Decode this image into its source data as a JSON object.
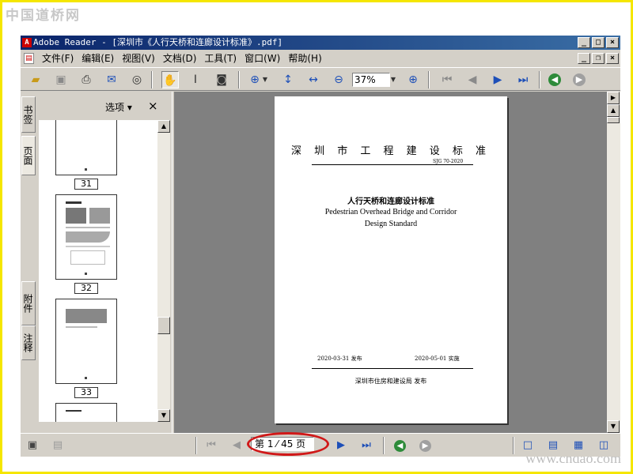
{
  "watermark": {
    "top": "中国道桥网",
    "bottom": "www.cndao.com"
  },
  "window": {
    "title": "Adobe Reader - [深圳市《人行天桥和连廊设计标准》.pdf]"
  },
  "menu": [
    "文件(F)",
    "编辑(E)",
    "视图(V)",
    "文档(D)",
    "工具(T)",
    "窗口(W)",
    "帮助(H)"
  ],
  "toolbar": {
    "zoom": "37%"
  },
  "panel": {
    "options_label": "选项",
    "close_glyph": "×",
    "left_tabs": [
      "书签",
      "页面",
      "附件",
      "注释"
    ],
    "thumbnails": [
      "31",
      "32",
      "33"
    ]
  },
  "document": {
    "heading": "深 圳 市 工 程 建 设 标 准",
    "code": "SJG 70-2020",
    "title_cn": "人行天桥和连廊设计标准",
    "title_en_1": "Pedestrian Overhead Bridge and Corridor",
    "title_en_2": "Design Standard",
    "issued": "2020-03-31 发布",
    "effective": "2020-05-01 实施",
    "publisher": "深圳市住房和建设局   发布"
  },
  "status": {
    "page": "第 1 ⁄ 45 页"
  },
  "colors": {
    "highlight_circle": "#d01818",
    "title_bar": "#0a246a",
    "frame": "#f5e600"
  }
}
